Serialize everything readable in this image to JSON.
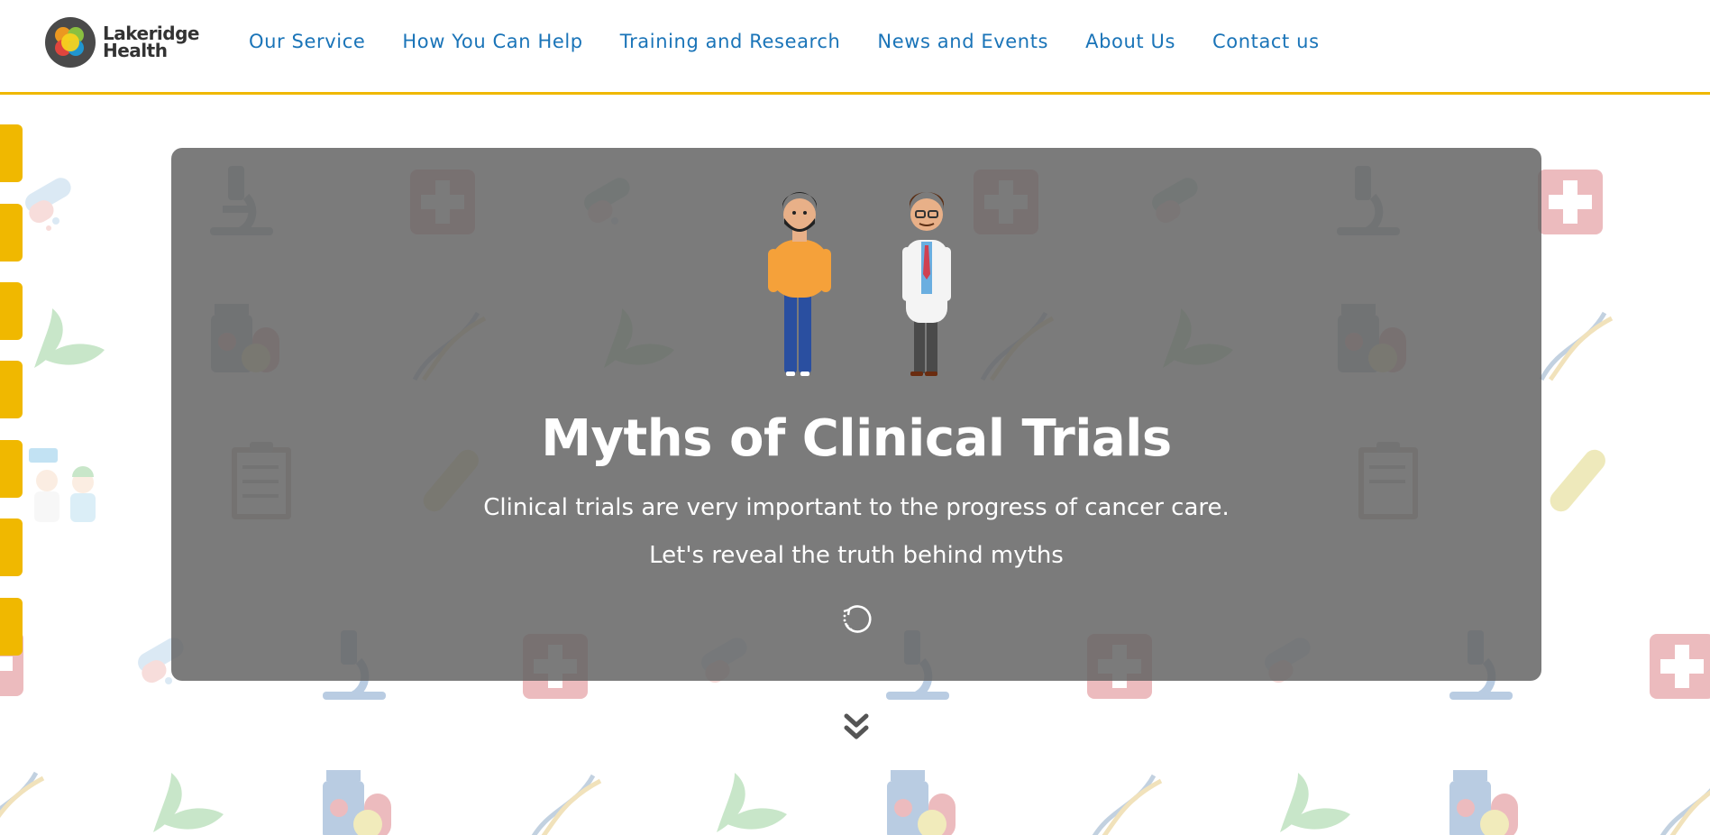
{
  "brand": {
    "line1": "Lakeridge",
    "line2": "Health"
  },
  "nav": {
    "items": [
      {
        "label": "Our Service"
      },
      {
        "label": "How You Can Help"
      },
      {
        "label": "Training and Research"
      },
      {
        "label": "News and Events"
      },
      {
        "label": "About Us"
      },
      {
        "label": "Contact us"
      }
    ]
  },
  "hero": {
    "title": "Myths of Clinical Trials",
    "line1": "Clinical trials are very important to the progress of cancer care.",
    "line2": "Let's reveal the truth behind myths",
    "reload_icon": "refresh-icon",
    "scroll_icon": "double-chevron-down-icon"
  },
  "colors": {
    "nav_link": "#1a74b8",
    "accent": "#f0b800",
    "hero_overlay": "#646464",
    "text_on_hero": "#ffffff"
  }
}
